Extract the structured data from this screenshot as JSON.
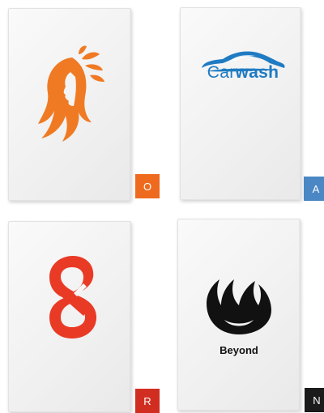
{
  "cards": [
    {
      "logo_name": "woman-hair-leaves-logo",
      "logo_color": "#f07a24",
      "badge": {
        "label": "O",
        "color": "#ee6a1f"
      }
    },
    {
      "logo_name": "car-silhouette-logo",
      "logo_color": "#1f7bc2",
      "brand_text_a": "Car",
      "brand_text_b": "wash",
      "badge": {
        "label": "A",
        "color": "#4a87c4"
      }
    },
    {
      "logo_name": "infinity-eight-logo",
      "logo_color": "#e93a26",
      "badge": {
        "label": "R",
        "color": "#d12e22"
      }
    },
    {
      "logo_name": "flame-crescent-logo",
      "logo_color": "#111111",
      "brand_text": "Beyond",
      "badge": {
        "label": "N",
        "color": "#1b1b1b"
      }
    }
  ]
}
